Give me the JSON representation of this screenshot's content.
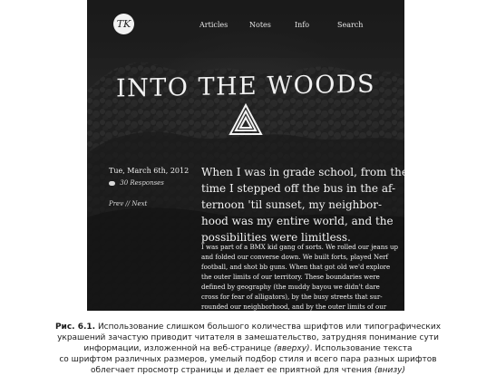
{
  "screenshot": {
    "nav": {
      "items": [
        "Articles",
        "Notes",
        "Info",
        "Search"
      ]
    },
    "logo_text": "TK",
    "headline": "INTO THE WOODS",
    "post_meta": {
      "date": "Tue, March 6th, 2012",
      "responses": "30 Responses",
      "pager": "Prev // Next"
    },
    "lead_lines": [
      "When I was in grade school, from the",
      "time I stepped off the bus in the af-",
      "ternoon 'til sunset, my neighbor-",
      "hood was my entire world, and the",
      "possibilities were limitless."
    ],
    "body_lines": [
      "I was part of a BMX kid gang of sorts. We rolled our jeans up",
      "and folded our converse down. We built forts, played Nerf",
      "football, and shot bb guns. When that got old we'd explore",
      "the outer limits of our territory. These boundaries were",
      "defined by geography (the muddy bayou we didn't dare",
      "cross for fear of alligators), by the busy streets that sur-",
      "rounded our neighborhood, and by the outer limits of our"
    ]
  },
  "caption": {
    "label": "Рис. 6.1.",
    "line1": " Использование слишком большого количества шрифтов или типографических",
    "line2": "украшений зачастую приводит читателя в замешательство, затрудняя понимание сути",
    "line3a": "информации, изложенной на веб-странице ",
    "line3b": "(вверху)",
    "line3c": ". Использование текста",
    "line4": "со шрифтом различных размеров, умелый подбор стиля и всего пара разных шрифтов",
    "line5a": "облегчает просмотр страницы и делает ее приятной для чтения ",
    "line5b": "(внизу)"
  }
}
